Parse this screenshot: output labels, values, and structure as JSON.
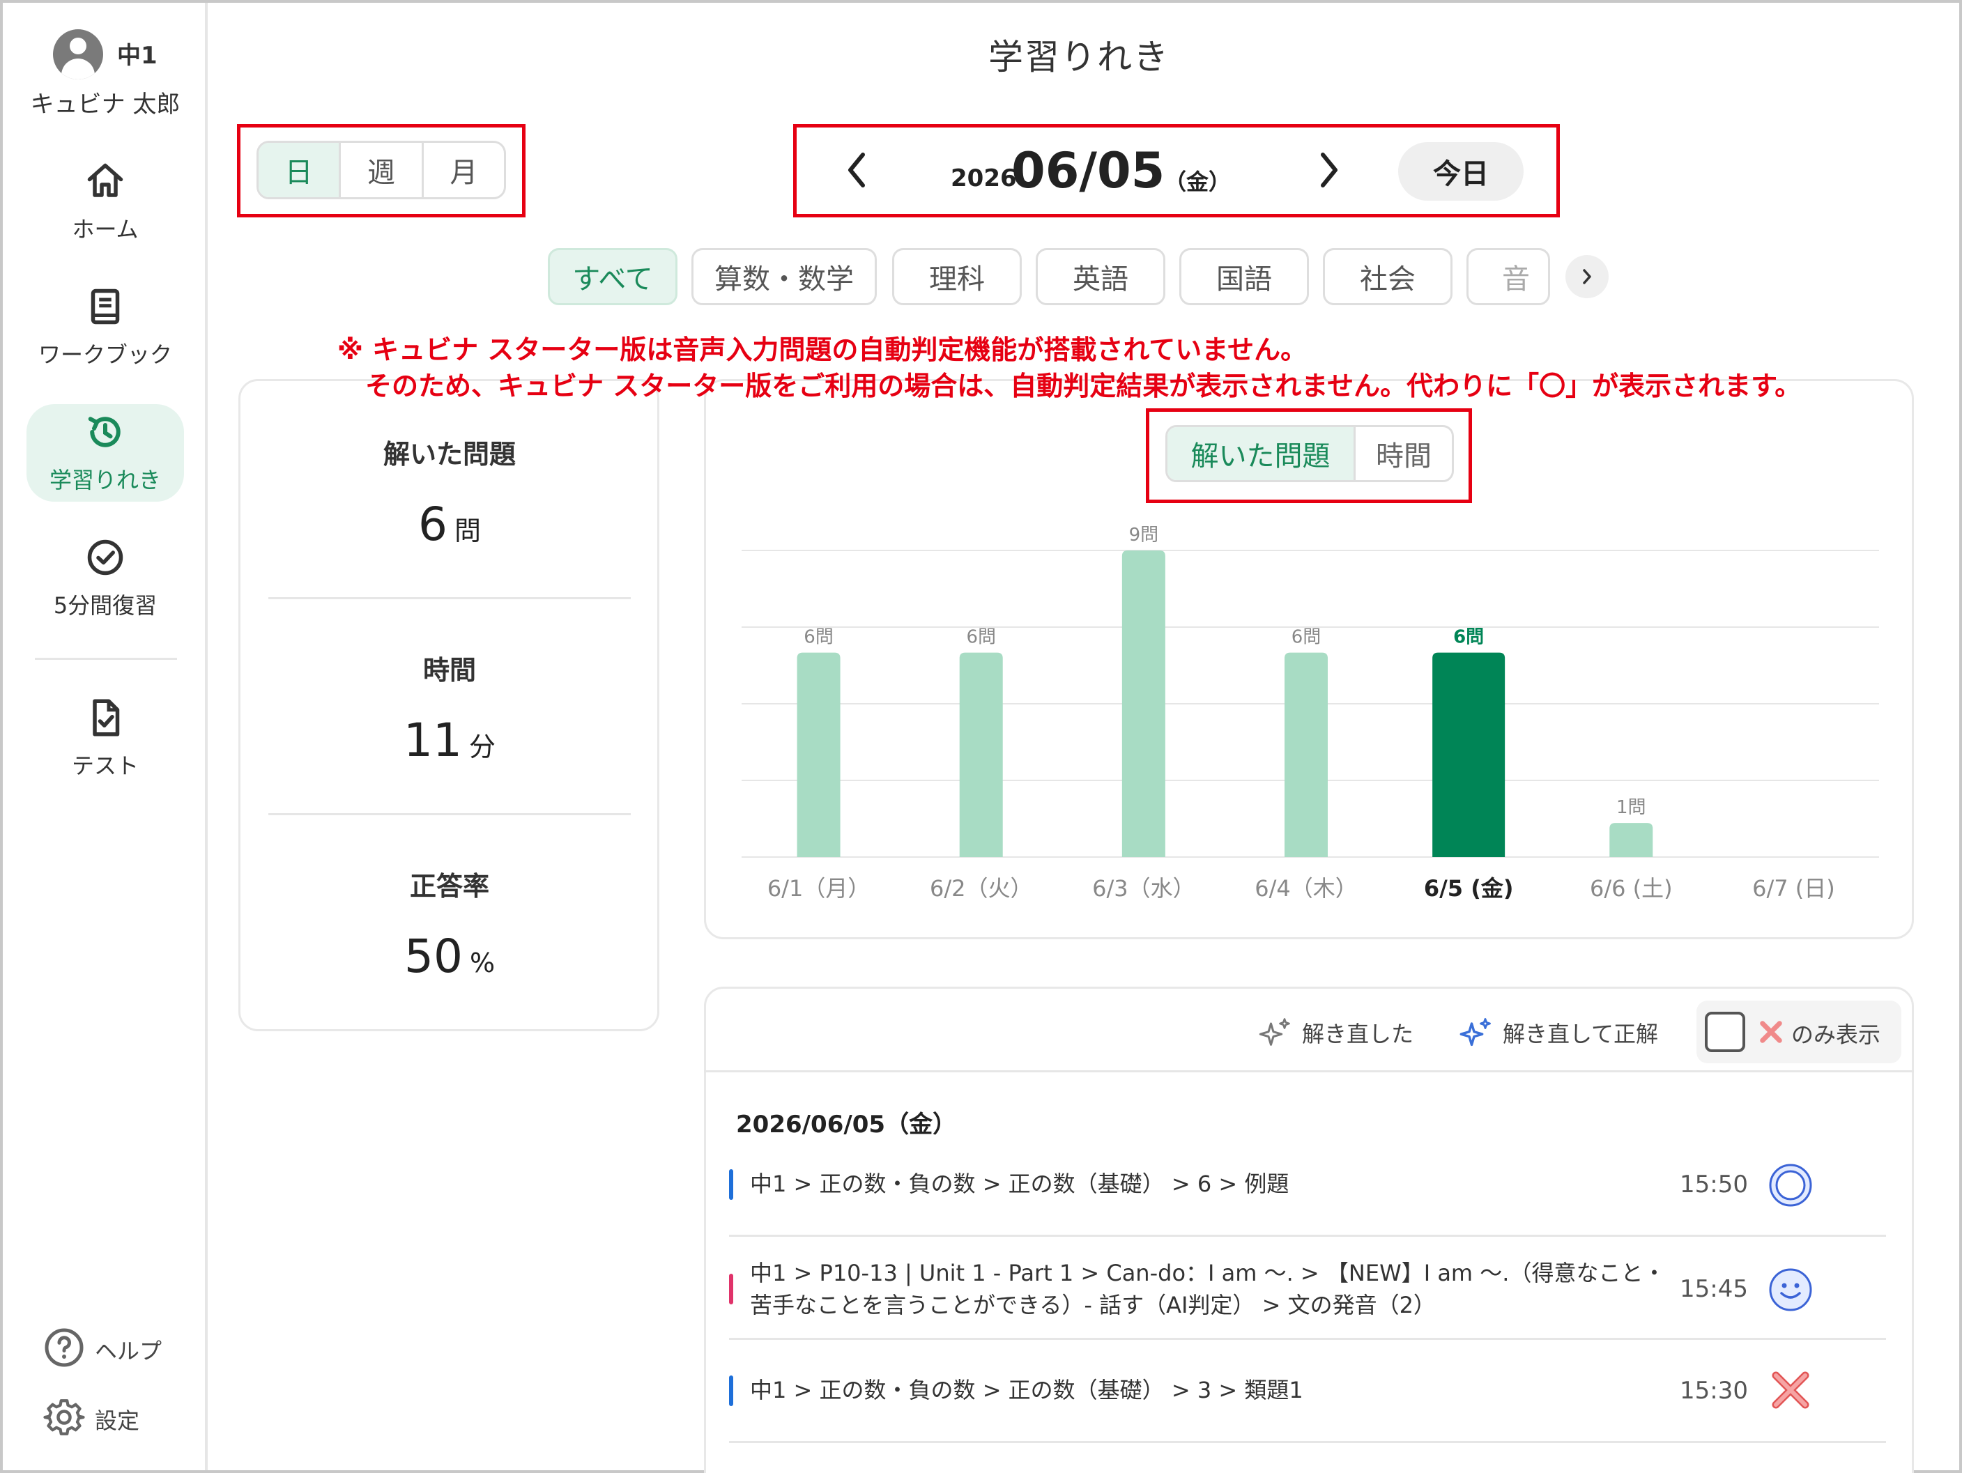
{
  "sidebar": {
    "grade": "中1",
    "user_name": "キュビナ 太郎",
    "items": [
      {
        "label": "ホーム",
        "icon": "home-icon"
      },
      {
        "label": "ワークブック",
        "icon": "book-icon"
      },
      {
        "label": "学習りれき",
        "icon": "history-icon",
        "active": true
      },
      {
        "label": "5分間復習",
        "icon": "check-circle-icon"
      },
      {
        "label": "テスト",
        "icon": "test-document-icon"
      }
    ],
    "help_label": "ヘルプ",
    "settings_label": "設定"
  },
  "page_title": "学習りれき",
  "period_toggle": {
    "options": [
      "日",
      "週",
      "月"
    ],
    "selected": "日"
  },
  "date_nav": {
    "year": "2026",
    "month_day": "06/05",
    "weekday": "（金）",
    "today_label": "今日"
  },
  "subject_tabs": [
    "すべて",
    "算数・数学",
    "理科",
    "英語",
    "国語",
    "社会",
    "音"
  ],
  "notice": {
    "line1": "※ キュビナ スターター版は音声入力問題の自動判定機能が搭載されていません。",
    "line2": "そのため、キュビナ スターター版をご利用の場合は、自動判定結果が表示されません。代わりに「〇」が表示されます。"
  },
  "summary": {
    "solved_label": "解いた問題",
    "solved_value": "6",
    "solved_unit": "問",
    "time_label": "時間",
    "time_value": "11",
    "time_unit": "分",
    "accuracy_label": "正答率",
    "accuracy_value": "50",
    "accuracy_unit": "%"
  },
  "metric_toggle": {
    "options": [
      "解いた問題",
      "時間"
    ],
    "selected": "解いた問題"
  },
  "chart_data": {
    "type": "bar",
    "categories": [
      "6/1（月）",
      "6/2（火）",
      "6/3（水）",
      "6/4（木）",
      "6/5 (金)",
      "6/6 (土)",
      "6/7 (日)"
    ],
    "values": [
      6,
      6,
      9,
      6,
      6,
      1,
      0
    ],
    "value_labels": [
      "6問",
      "6問",
      "9問",
      "6問",
      "6問",
      "1問",
      ""
    ],
    "highlight_index": 4,
    "ylim": [
      0,
      9
    ],
    "grid": true,
    "colors": {
      "bar": "#a8dcc4",
      "highlight": "#008556",
      "grid": "#e6e6e6",
      "label": "#888888"
    }
  },
  "filters": {
    "retried_label": "解き直した",
    "retried_correct_label": "解き直して正解",
    "only_label": "のみ表示"
  },
  "history": {
    "date": "2026/06/05（金）",
    "rows": [
      {
        "path": "中1 > 正の数・負の数 > 正の数（基礎） > 6 > 例題",
        "time": "15:50",
        "result": "circle",
        "color": "#1e6fd9"
      },
      {
        "path": "中1 > P10-13 | Unit 1 - Part 1 > Can-do：I am 〜. > 【NEW】I am 〜.（得意なこと・苦手なことを言うことができる）- 話す（AI判定） > 文の発音（2）",
        "time": "15:45",
        "result": "smile",
        "color": "#e0336a"
      },
      {
        "path": "中1 > 正の数・負の数 > 正の数（基礎） > 3 > 類題1",
        "time": "15:30",
        "result": "cross",
        "color": "#1e6fd9"
      }
    ]
  },
  "colors": {
    "accent": "#1a8a5a",
    "accent_bg": "#e6f4ee",
    "annotation": "#e60012"
  }
}
